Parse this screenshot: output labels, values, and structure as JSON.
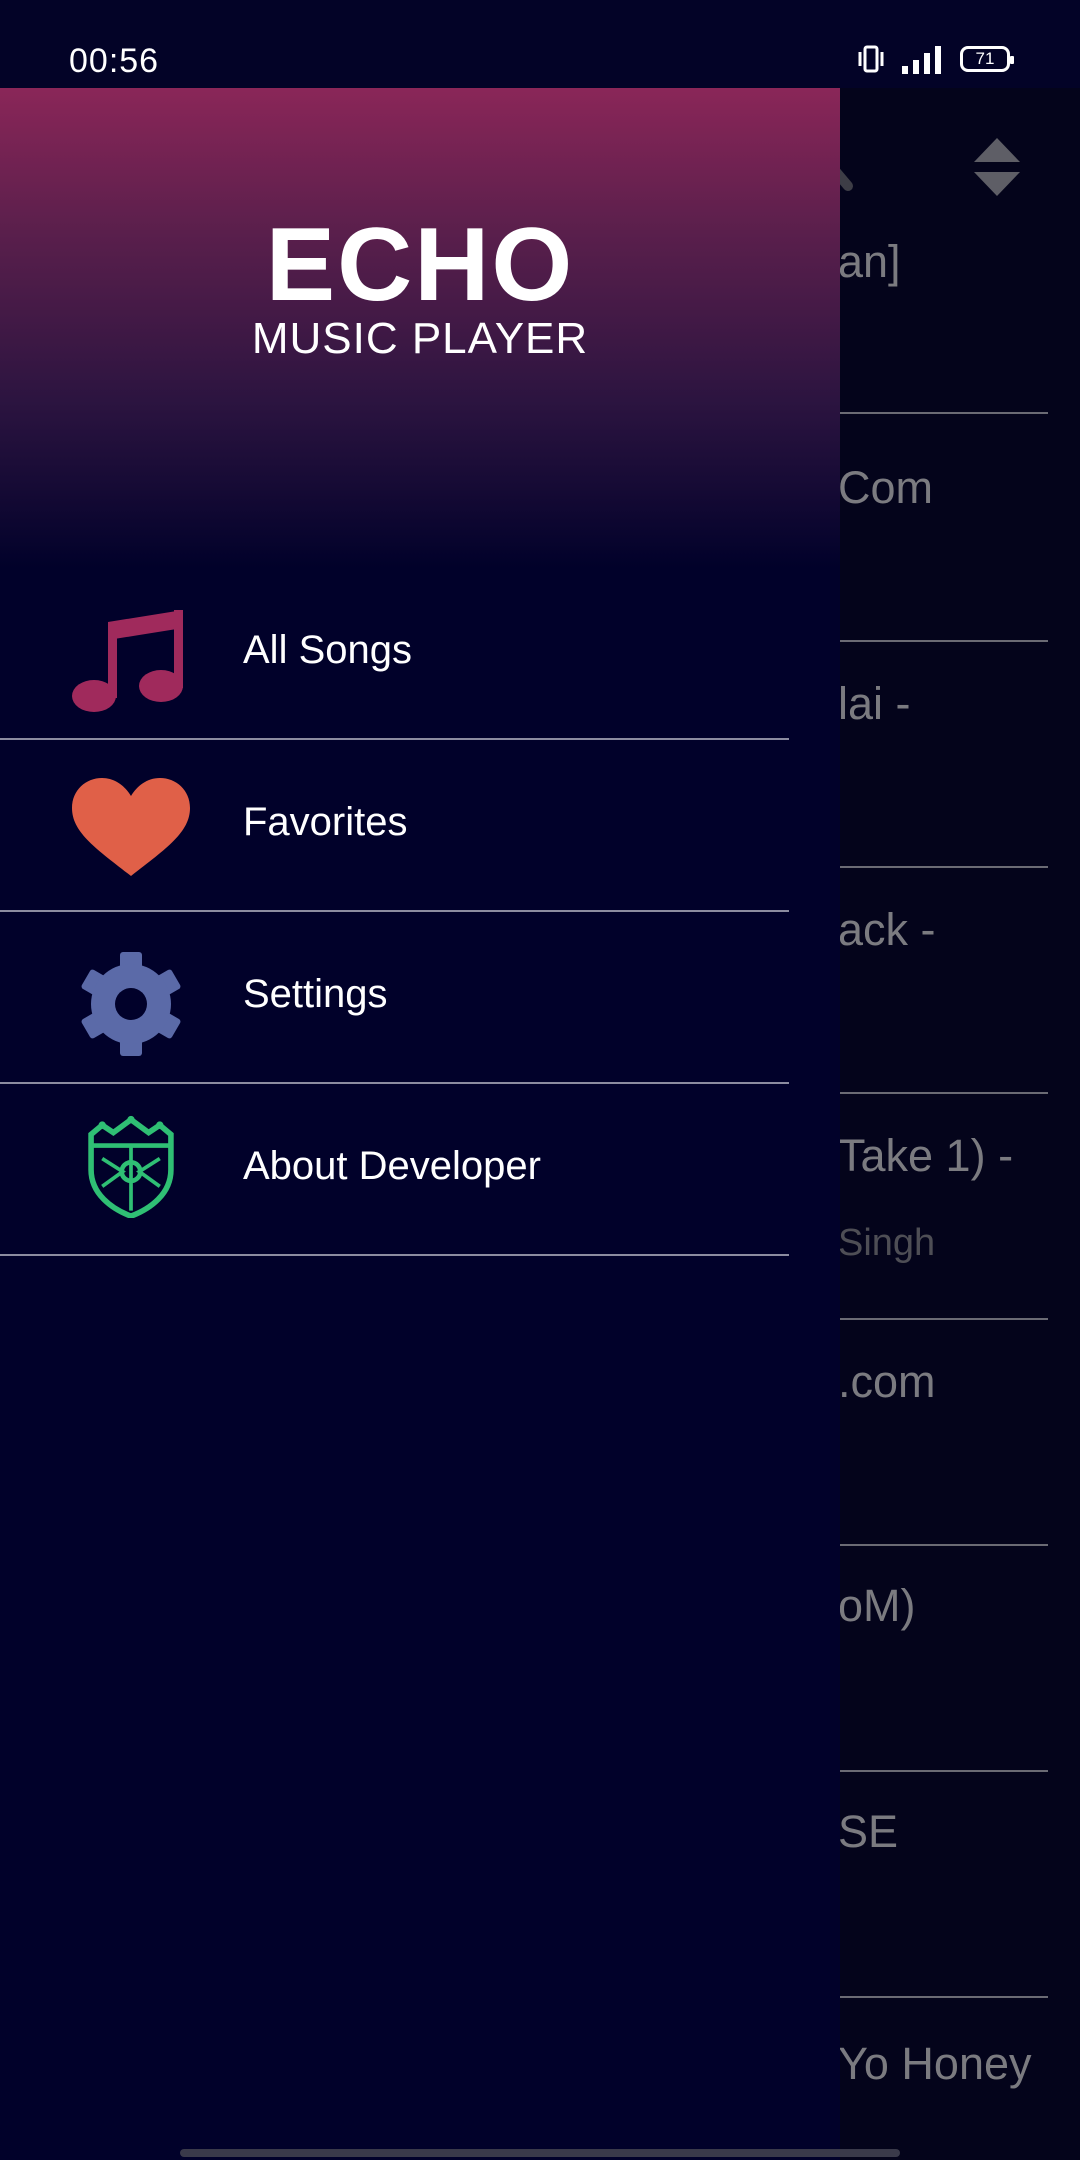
{
  "status_bar": {
    "time": "00:56",
    "battery": "71",
    "icons": [
      "vibrate-icon",
      "signal-icon",
      "battery-icon"
    ]
  },
  "drawer": {
    "logo_title": "ECHO",
    "logo_subtitle": "MUSIC PLAYER",
    "items": [
      {
        "label": "All Songs",
        "icon": "music-note-icon",
        "color": "#a02a5c"
      },
      {
        "label": "Favorites",
        "icon": "heart-icon",
        "color": "#e06048"
      },
      {
        "label": "Settings",
        "icon": "gear-icon",
        "color": "#5b6aa8"
      },
      {
        "label": "About Developer",
        "icon": "crest-icon",
        "color": "#2fbf74"
      }
    ]
  },
  "background_list": {
    "rows": [
      {
        "title": "an]",
        "subtitle": ""
      },
      {
        "title": "Com",
        "subtitle": ""
      },
      {
        "title": "lai -",
        "subtitle": ""
      },
      {
        "title": "ack -",
        "subtitle": ""
      },
      {
        "title": "Take 1) -",
        "subtitle": "Singh"
      },
      {
        "title": ".com",
        "subtitle": ""
      },
      {
        "title": "oM)",
        "subtitle": ""
      },
      {
        "title": "SE",
        "subtitle": ""
      },
      {
        "title": "Yo Honey",
        "subtitle": ""
      }
    ]
  },
  "colors": {
    "drawer_bg": "#01012a",
    "header_top": "#8a2658",
    "divider": "#8c8ca0"
  }
}
